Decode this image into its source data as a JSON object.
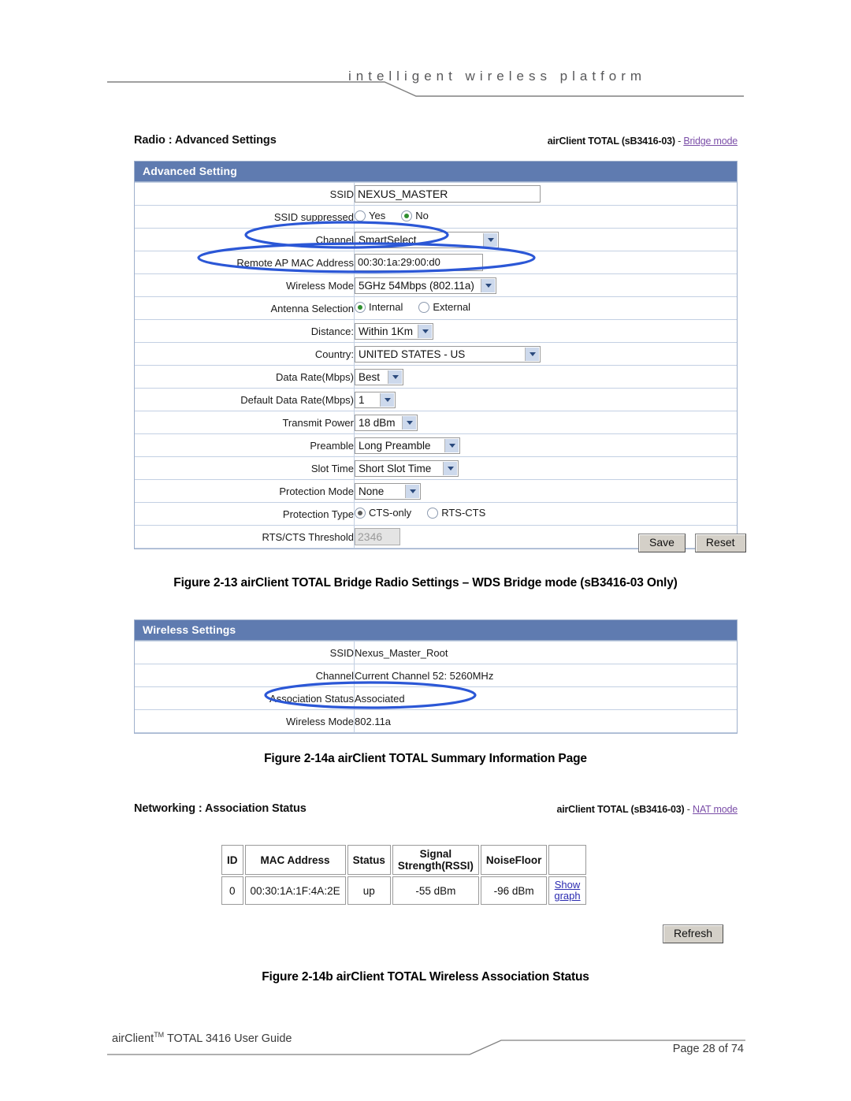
{
  "banner": {
    "tagline": "intelligent  wireless   platform"
  },
  "section1": {
    "title": "Radio : Advanced Settings",
    "device": "airClient TOTAL (sB3416-03)",
    "separator": " - ",
    "mode_link": "Bridge mode",
    "panel_title": "Advanced Setting",
    "rows": [
      {
        "label": "SSID",
        "type": "text",
        "value": "NEXUS_MASTER"
      },
      {
        "label": "SSID suppressed",
        "type": "radio",
        "options": [
          "Yes",
          "No"
        ],
        "selected": "No"
      },
      {
        "label": "Channel",
        "type": "select",
        "value": "SmartSelect"
      },
      {
        "label": "Remote AP MAC Address",
        "type": "text",
        "value": "00:30:1a:29:00:d0"
      },
      {
        "label": "Wireless Mode",
        "type": "select",
        "value": "5GHz 54Mbps (802.11a)"
      },
      {
        "label": "Antenna Selection",
        "type": "radio",
        "options": [
          "Internal",
          "External"
        ],
        "selected": "Internal"
      },
      {
        "label": "Distance:",
        "type": "select",
        "value": "Within 1Km"
      },
      {
        "label": "Country:",
        "type": "select",
        "value": "UNITED STATES - US"
      },
      {
        "label": "Data Rate(Mbps)",
        "type": "select",
        "value": "Best"
      },
      {
        "label": "Default Data Rate(Mbps)",
        "type": "select",
        "value": "1"
      },
      {
        "label": "Transmit Power",
        "type": "select",
        "value": "18 dBm"
      },
      {
        "label": "Preamble",
        "type": "select",
        "value": "Long Preamble"
      },
      {
        "label": "Slot Time",
        "type": "select",
        "value": "Short Slot Time"
      },
      {
        "label": "Protection Mode",
        "type": "select",
        "value": "None"
      },
      {
        "label": "Protection Type",
        "type": "radio",
        "options": [
          "CTS-only",
          "RTS-CTS"
        ],
        "selected": "CTS-only"
      },
      {
        "label": "RTS/CTS Threshold",
        "type": "text-disabled",
        "value": "2346"
      }
    ],
    "save_label": "Save",
    "reset_label": "Reset",
    "caption": "Figure 2-13 airClient TOTAL Bridge Radio Settings – WDS Bridge mode (sB3416-03 Only)"
  },
  "section2": {
    "panel_title": "Wireless Settings",
    "rows": [
      {
        "label": "SSID",
        "value": "Nexus_Master_Root"
      },
      {
        "label": "Channel",
        "value": "Current Channel 52: 5260MHz"
      },
      {
        "label": "Association Status",
        "value": "Associated"
      },
      {
        "label": "Wireless Mode",
        "value": "802.11a"
      }
    ],
    "caption": "Figure 2-14a airClient TOTAL Summary Information Page"
  },
  "section3": {
    "title": "Networking : Association Status",
    "device": "airClient TOTAL (sB3416-03)",
    "separator": " - ",
    "mode_link": "NAT mode",
    "headers": [
      "ID",
      "MAC Address",
      "Status",
      "Signal\nStrength(RSSI)",
      "NoiseFloor",
      ""
    ],
    "header_signal_line1": "Signal",
    "header_signal_line2": "Strength(RSSI)",
    "rows": [
      {
        "id": "0",
        "mac": "00:30:1A:1F:4A:2E",
        "status": "up",
        "rssi": "-55 dBm",
        "noisefloor": "-96  dBm",
        "link_line1": "Show",
        "link_line2": "graph"
      }
    ],
    "refresh_label": "Refresh",
    "caption": "Figure 2-14b  airClient TOTAL Wireless Association Status"
  },
  "footer": {
    "left_main": "airClient",
    "left_tm": "TM",
    "left_rest": " TOTAL 3416 User Guide",
    "right": "Page 28 of 74"
  },
  "colors": {
    "panel_header": "#5f7bb0",
    "annotation": "#2b57d6",
    "mode_link": "#7b4ea8",
    "show_graph_link": "#2a2ab0"
  }
}
